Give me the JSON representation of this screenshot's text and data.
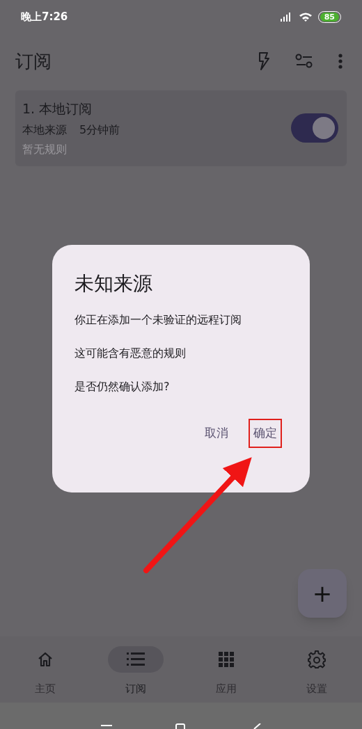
{
  "status_bar": {
    "time": "晚上7:26",
    "battery": "85"
  },
  "app_bar": {
    "title": "订阅"
  },
  "subscriptions": [
    {
      "title": "1. 本地订阅",
      "source": "本地来源",
      "time": "5分钟前",
      "rules": "暂无规则",
      "enabled": true
    }
  ],
  "dialog": {
    "title": "未知来源",
    "messages": [
      "你正在添加一个未验证的远程订阅",
      "这可能含有恶意的规则",
      "是否仍然确认添加?"
    ],
    "buttons": [
      {
        "label": "取消",
        "highlighted": false
      },
      {
        "label": "确定",
        "highlighted": true
      }
    ]
  },
  "fab": {
    "label": "+"
  },
  "bottom_nav": [
    {
      "kind": "home",
      "label": "主页",
      "selected": false
    },
    {
      "kind": "list",
      "label": "订阅",
      "selected": true
    },
    {
      "kind": "apps",
      "label": "应用",
      "selected": false
    },
    {
      "kind": "settings",
      "label": "设置",
      "selected": false
    }
  ]
}
